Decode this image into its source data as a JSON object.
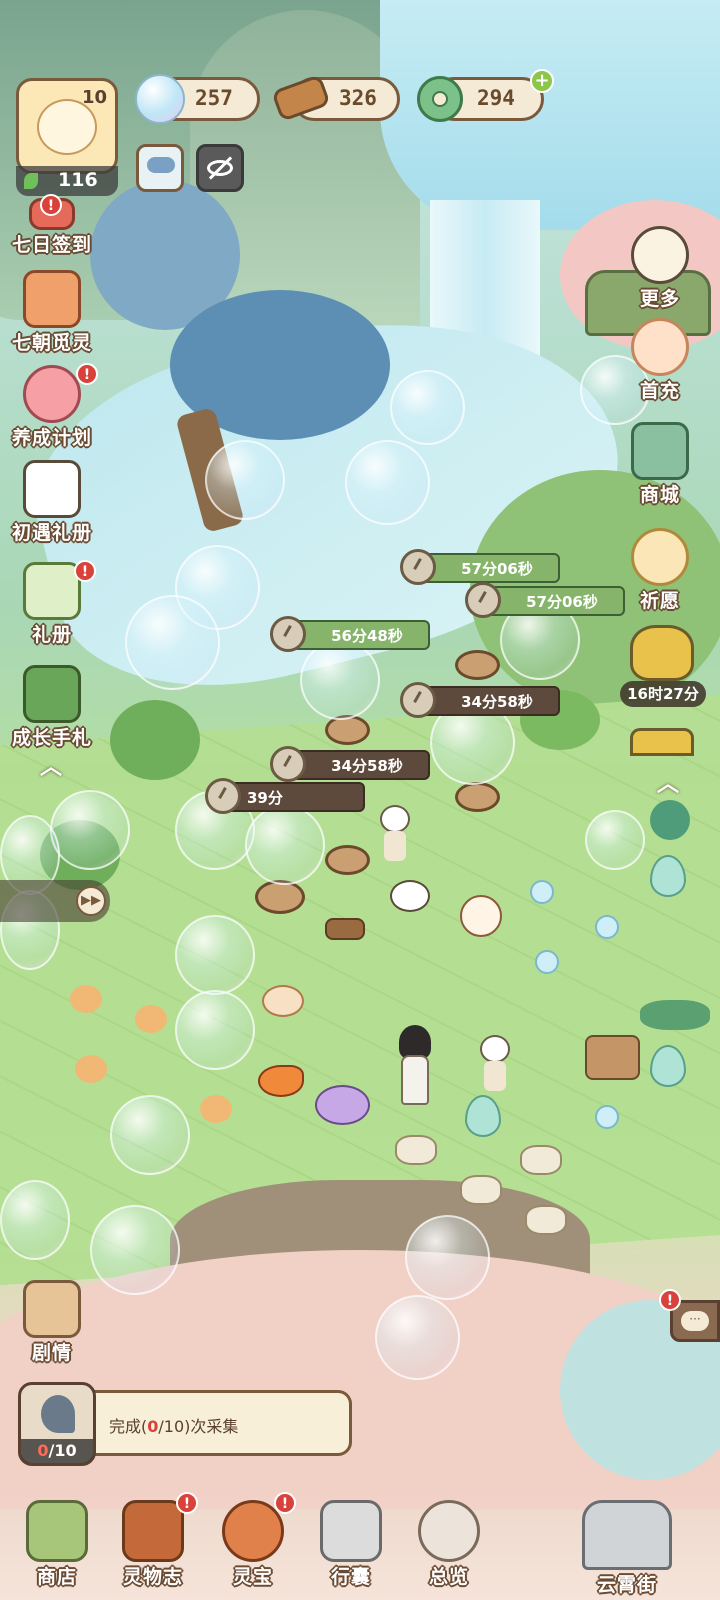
{
  "player": {
    "level": "10",
    "stamina": "116"
  },
  "resources": {
    "bubbles": "257",
    "wood": "326",
    "coins": "294"
  },
  "left_menu": [
    {
      "label": "七日签到"
    },
    {
      "label": "七朝觅灵"
    },
    {
      "label": "养成计划"
    },
    {
      "label": "初遇礼册"
    },
    {
      "label": "礼册"
    },
    {
      "label": "成长手札"
    }
  ],
  "right_menu": [
    {
      "label": "更多"
    },
    {
      "label": "首充"
    },
    {
      "label": "商城"
    },
    {
      "label": "祈愿"
    }
  ],
  "right_timer": "16时27分",
  "timers": [
    "57分06秒",
    "57分06秒",
    "56分48秒",
    "34分58秒",
    "34分58秒",
    "39分"
  ],
  "story": {
    "label": "剧情"
  },
  "task": {
    "prefix": "完成(",
    "current": "0",
    "suffix": "/10)次采集",
    "progress_current": "0",
    "progress_total": "/10"
  },
  "bottom_nav": [
    {
      "label": "商店"
    },
    {
      "label": "灵物志"
    },
    {
      "label": "灵宝"
    },
    {
      "label": "行囊"
    },
    {
      "label": "总览"
    },
    {
      "label": "云霄街"
    }
  ],
  "colors": {
    "accent_brown": "#7a5a3c",
    "timer_green": "#86b46a",
    "badge_red": "#d8423a",
    "grass": "#b9e29a"
  }
}
